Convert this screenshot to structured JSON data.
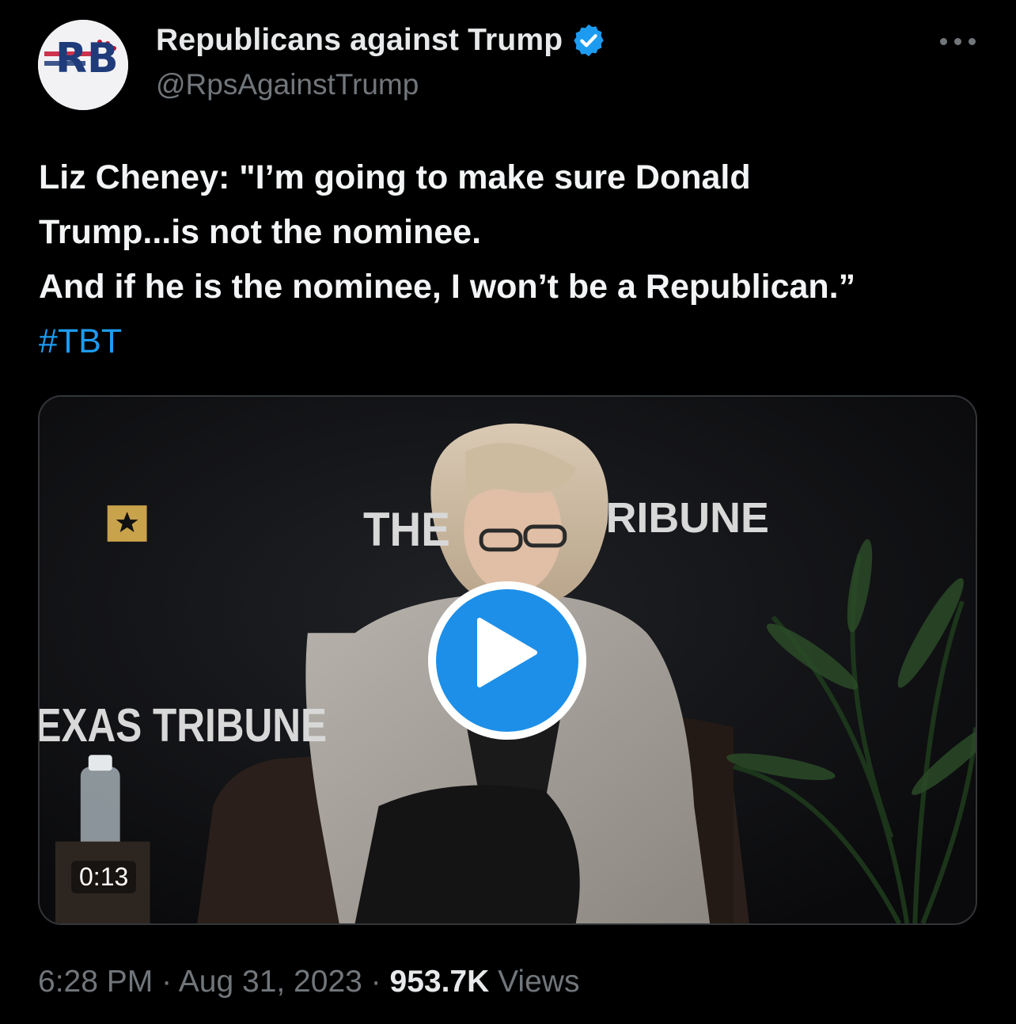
{
  "author": {
    "display_name": "Republicans against Trump",
    "handle": "@RpsAgainstTrump",
    "avatar_text": "RB",
    "verified": true
  },
  "tweet": {
    "lines": [
      "Liz Cheney: \"I’m going to make sure Donald",
      "Trump...is not the nominee.",
      "And if he is the nominee, I won’t be a Republican.”"
    ],
    "hashtag": "#TBT"
  },
  "video": {
    "duration": "0:13",
    "backdrop_text_top_left": "THE",
    "backdrop_text_top_right": "RIBUNE",
    "backdrop_text_left": "EXAS TRIBUNE"
  },
  "footer": {
    "time": "6:28 PM",
    "separator": "·",
    "date": "Aug 31, 2023",
    "views_count": "953.7K",
    "views_label": "Views"
  },
  "colors": {
    "link": "#1d9bf0",
    "verified_badge": "#1d9bf0",
    "play_button": "#1d8fe8",
    "secondary_text": "#71767b"
  }
}
